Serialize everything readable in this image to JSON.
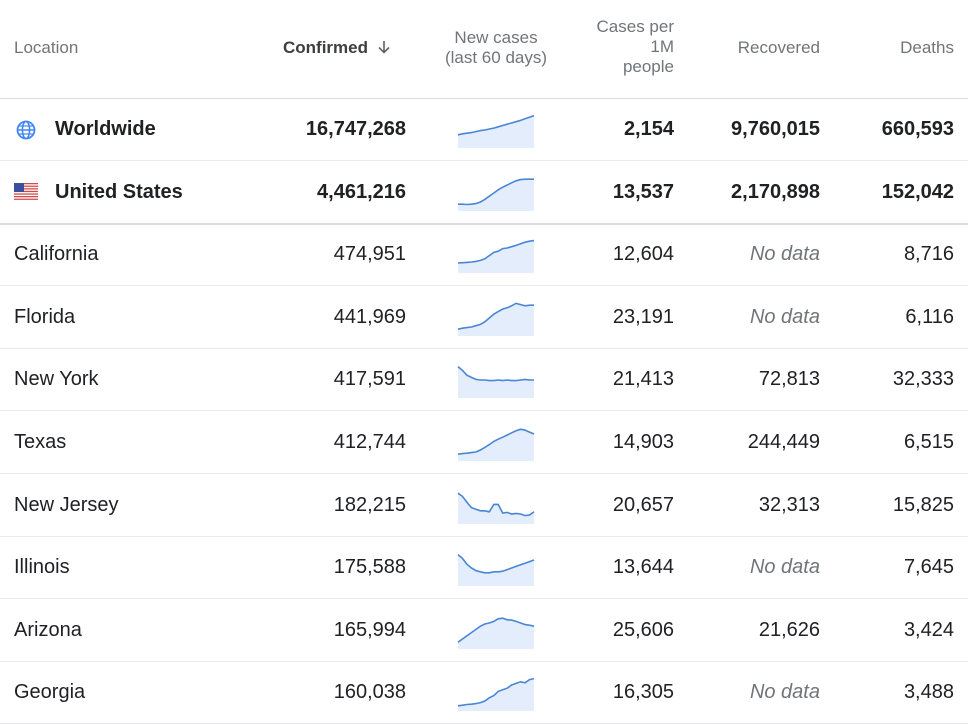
{
  "header": {
    "location": "Location",
    "confirmed": "Confirmed",
    "new_cases_line1": "New cases",
    "new_cases_line2": "(last 60 days)",
    "cases_per_line1": "Cases per",
    "cases_per_line2": "1M",
    "cases_per_line3": "people",
    "recovered": "Recovered",
    "deaths": "Deaths"
  },
  "colors": {
    "spark_line": "#4a86d4",
    "spark_fill": "#e3edfb",
    "globe": "#4285f4",
    "flag_red": "#d14d4d",
    "flag_blue": "#3c4f9c"
  },
  "rows": [
    {
      "location": "Worldwide",
      "icon": "globe-icon",
      "confirmed": "16,747,268",
      "cases_per_1m": "2,154",
      "recovered": "9,760,015",
      "deaths": "660,593",
      "trend": [
        0.35,
        0.38,
        0.4,
        0.42,
        0.45,
        0.48,
        0.5,
        0.53,
        0.56,
        0.6,
        0.64,
        0.68,
        0.72,
        0.76,
        0.8,
        0.85,
        0.9,
        0.95
      ]
    },
    {
      "location": "United States",
      "icon": "us-flag-icon",
      "confirmed": "4,461,216",
      "cases_per_1m": "13,537",
      "recovered": "2,170,898",
      "deaths": "152,042",
      "trend": [
        0.15,
        0.15,
        0.14,
        0.15,
        0.17,
        0.22,
        0.3,
        0.4,
        0.5,
        0.6,
        0.68,
        0.75,
        0.82,
        0.88,
        0.92,
        0.93,
        0.93,
        0.93
      ]
    },
    {
      "location": "California",
      "confirmed": "474,951",
      "cases_per_1m": "12,604",
      "recovered": "No data",
      "recovered_missing": true,
      "deaths": "8,716",
      "trend": [
        0.25,
        0.26,
        0.27,
        0.28,
        0.3,
        0.33,
        0.38,
        0.48,
        0.58,
        0.62,
        0.7,
        0.72,
        0.76,
        0.8,
        0.85,
        0.9,
        0.93,
        0.95
      ]
    },
    {
      "location": "Florida",
      "confirmed": "441,969",
      "cases_per_1m": "23,191",
      "recovered": "No data",
      "recovered_missing": true,
      "deaths": "6,116",
      "trend": [
        0.15,
        0.18,
        0.2,
        0.22,
        0.26,
        0.3,
        0.38,
        0.5,
        0.62,
        0.7,
        0.78,
        0.82,
        0.88,
        0.96,
        0.92,
        0.88,
        0.9,
        0.9
      ]
    },
    {
      "location": "New York",
      "confirmed": "417,591",
      "cases_per_1m": "21,413",
      "recovered": "72,813",
      "deaths": "32,333",
      "trend": [
        0.92,
        0.8,
        0.65,
        0.58,
        0.52,
        0.5,
        0.5,
        0.48,
        0.48,
        0.5,
        0.48,
        0.5,
        0.48,
        0.48,
        0.5,
        0.52,
        0.5,
        0.5
      ]
    },
    {
      "location": "Texas",
      "confirmed": "412,744",
      "cases_per_1m": "14,903",
      "recovered": "244,449",
      "deaths": "6,515",
      "trend": [
        0.15,
        0.17,
        0.18,
        0.2,
        0.22,
        0.28,
        0.36,
        0.45,
        0.55,
        0.62,
        0.68,
        0.75,
        0.82,
        0.88,
        0.93,
        0.9,
        0.84,
        0.78
      ]
    },
    {
      "location": "New Jersey",
      "confirmed": "182,215",
      "cases_per_1m": "20,657",
      "recovered": "32,313",
      "deaths": "15,825",
      "trend": [
        0.9,
        0.8,
        0.62,
        0.45,
        0.4,
        0.35,
        0.35,
        0.32,
        0.55,
        0.55,
        0.28,
        0.3,
        0.25,
        0.27,
        0.25,
        0.2,
        0.22,
        0.32
      ]
    },
    {
      "location": "Illinois",
      "confirmed": "175,588",
      "cases_per_1m": "13,644",
      "recovered": "No data",
      "recovered_missing": true,
      "deaths": "7,645",
      "trend": [
        0.92,
        0.8,
        0.62,
        0.5,
        0.42,
        0.38,
        0.35,
        0.35,
        0.38,
        0.38,
        0.4,
        0.45,
        0.5,
        0.55,
        0.6,
        0.65,
        0.7,
        0.75
      ]
    },
    {
      "location": "Arizona",
      "confirmed": "165,994",
      "cases_per_1m": "25,606",
      "recovered": "21,626",
      "deaths": "3,424",
      "trend": [
        0.15,
        0.25,
        0.35,
        0.45,
        0.55,
        0.65,
        0.72,
        0.75,
        0.8,
        0.88,
        0.9,
        0.85,
        0.84,
        0.8,
        0.75,
        0.7,
        0.68,
        0.65
      ]
    },
    {
      "location": "Georgia",
      "confirmed": "160,038",
      "cases_per_1m": "16,305",
      "recovered": "No data",
      "recovered_missing": true,
      "deaths": "3,488",
      "trend": [
        0.1,
        0.12,
        0.14,
        0.15,
        0.17,
        0.2,
        0.25,
        0.35,
        0.42,
        0.55,
        0.6,
        0.65,
        0.75,
        0.8,
        0.85,
        0.82,
        0.92,
        0.95
      ]
    }
  ]
}
